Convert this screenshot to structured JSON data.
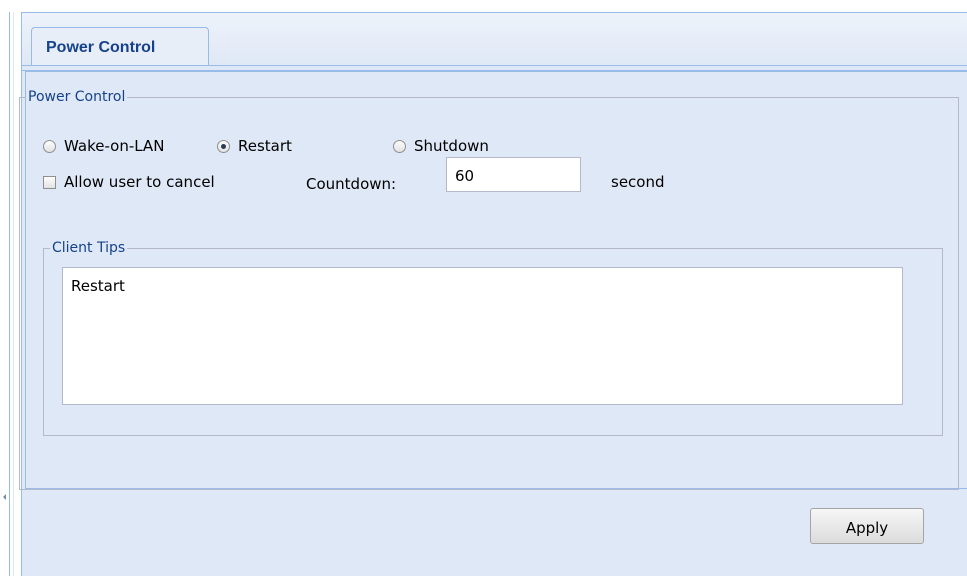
{
  "tab": {
    "label": "Power Control"
  },
  "power_control": {
    "legend": "Power Control",
    "options": [
      {
        "label": "Wake-on-LAN",
        "checked": false
      },
      {
        "label": "Restart",
        "checked": true
      },
      {
        "label": "Shutdown",
        "checked": false
      }
    ],
    "allow_cancel_label": "Allow user to cancel",
    "allow_cancel_checked": false,
    "countdown_label": "Countdown:",
    "countdown_value": "60",
    "countdown_unit": "second"
  },
  "client_tips": {
    "legend": "Client Tips",
    "text": "Restart"
  },
  "buttons": {
    "apply": "Apply"
  },
  "colors": {
    "accent": "#15428b",
    "panel_bg": "#dfe8f6",
    "border": "#99bbe8"
  }
}
